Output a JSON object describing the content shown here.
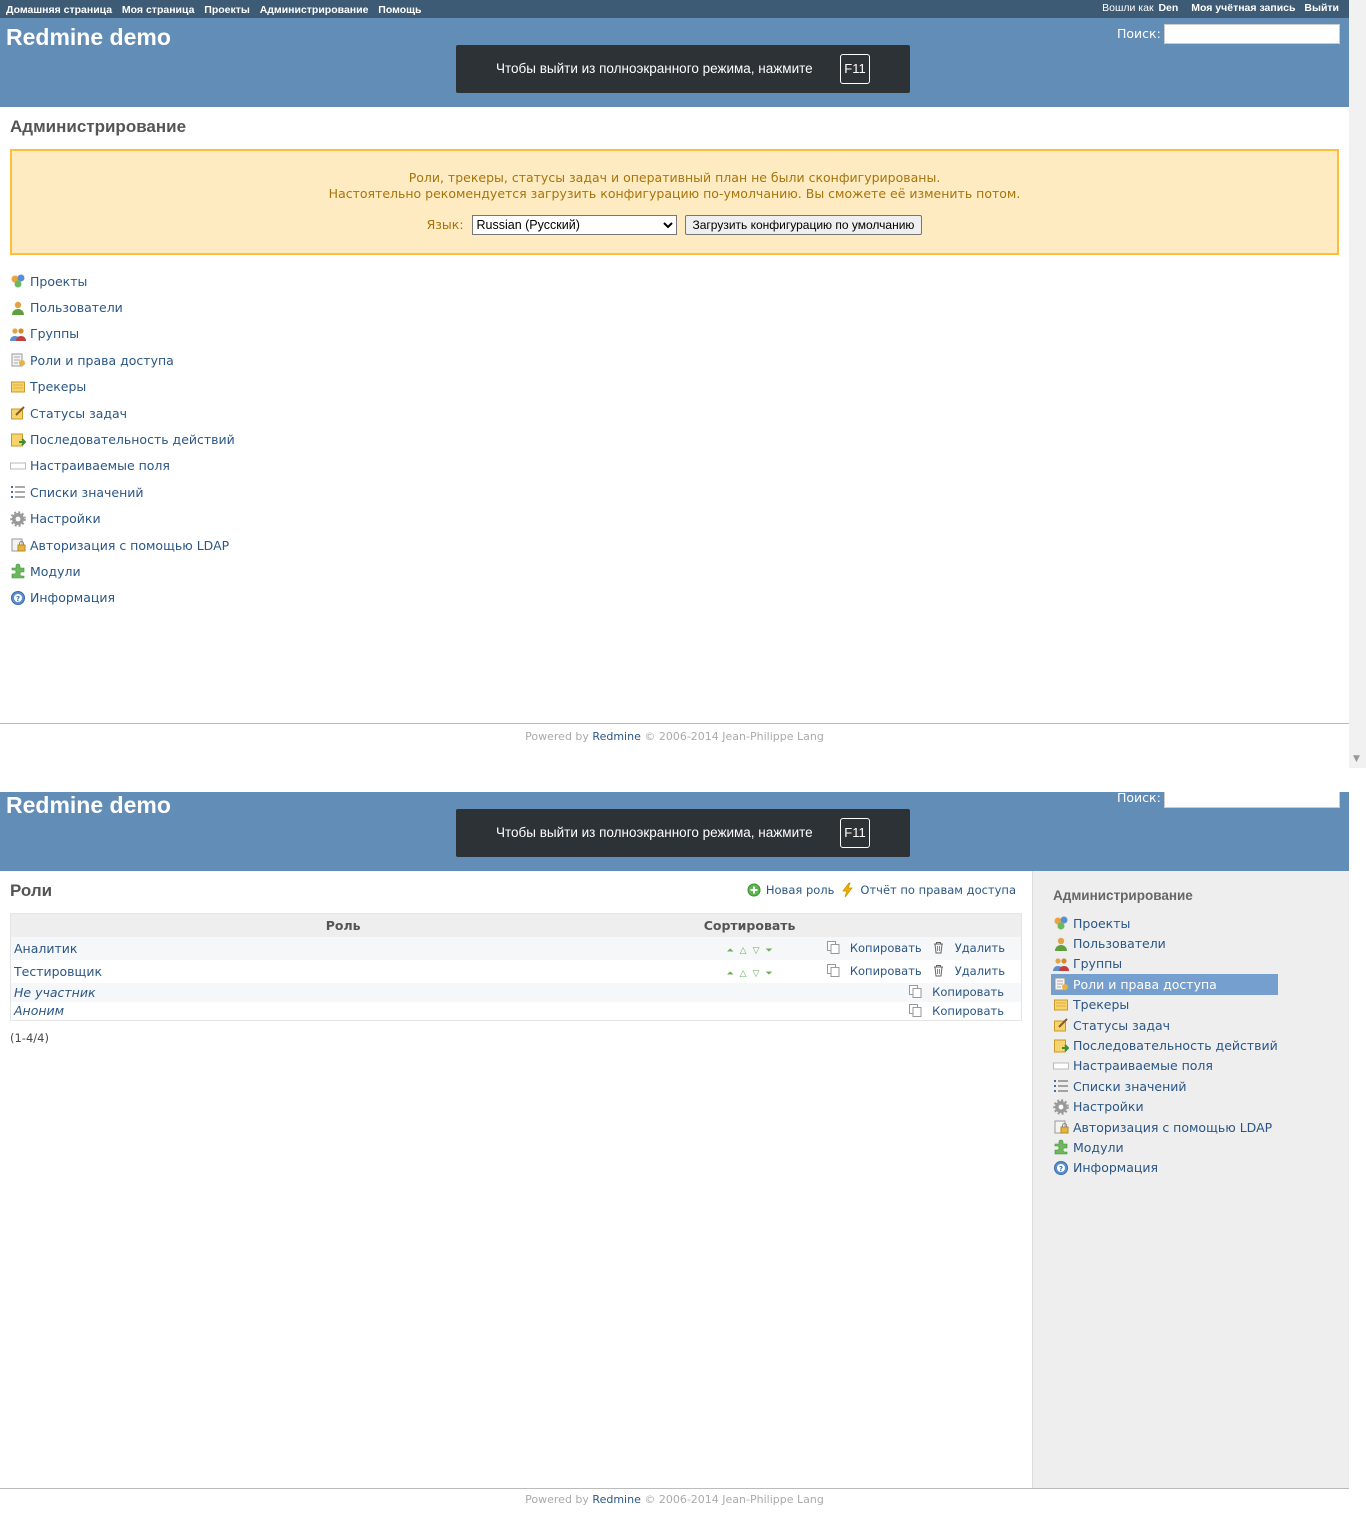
{
  "top_menu": {
    "items": [
      "Домашняя страница",
      "Моя страница",
      "Проекты",
      "Администрирование",
      "Помощь"
    ],
    "logged_in_prefix": "Вошли как",
    "username": "Den",
    "my_account": "Моя учётная запись",
    "logout": "Выйти"
  },
  "header": {
    "site_title": "Redmine demo",
    "search_label": "Поиск:",
    "search_value": ""
  },
  "fullscreen_toast": {
    "message": "Чтобы выйти из полноэкранного режима, нажмите",
    "key": "F11"
  },
  "admin_page": {
    "title": "Администрирование",
    "warning_line1": "Роли, трекеры, статусы задач и оперативный план не были сконфигурированы.",
    "warning_line2": "Настоятельно рекомендуется загрузить конфигурацию по-умолчанию. Вы сможете её изменить потом.",
    "language_label": "Язык:",
    "language_selected": "Russian (Русский)",
    "load_button": "Загрузить конфигурацию по умолчанию"
  },
  "admin_menu": [
    {
      "label": "Проекты",
      "icon": "projects-icon"
    },
    {
      "label": "Пользователи",
      "icon": "user-icon"
    },
    {
      "label": "Группы",
      "icon": "group-icon"
    },
    {
      "label": "Роли и права доступа",
      "icon": "roles-icon"
    },
    {
      "label": "Трекеры",
      "icon": "tracker-icon"
    },
    {
      "label": "Статусы задач",
      "icon": "issue-status-icon"
    },
    {
      "label": "Последовательность действий",
      "icon": "workflow-icon"
    },
    {
      "label": "Настраиваемые поля",
      "icon": "custom-fields-icon"
    },
    {
      "label": "Списки значений",
      "icon": "list-icon"
    },
    {
      "label": "Настройки",
      "icon": "gear-icon"
    },
    {
      "label": "Авторизация с помощью LDAP",
      "icon": "ldap-icon"
    },
    {
      "label": "Модули",
      "icon": "plugin-icon"
    },
    {
      "label": "Информация",
      "icon": "info-icon"
    }
  ],
  "footer": {
    "powered_by": "Powered by",
    "link": "Redmine",
    "copyright": "© 2006-2014 Jean-Philippe Lang"
  },
  "roles_page": {
    "title": "Роли",
    "new_role": "Новая роль",
    "permissions_report": "Отчёт по правам доступа",
    "columns": {
      "role": "Роль",
      "sort": "Сортировать"
    },
    "roles": [
      {
        "name": "Аналитик",
        "builtin": false,
        "copy": "Копировать",
        "delete": "Удалить"
      },
      {
        "name": "Тестировщик",
        "builtin": false,
        "copy": "Копировать",
        "delete": "Удалить"
      },
      {
        "name": "Не участник",
        "builtin": true,
        "copy": "Копировать"
      },
      {
        "name": "Аноним",
        "builtin": true,
        "copy": "Копировать"
      }
    ],
    "pagination": "(1-4/4)"
  },
  "sidebar": {
    "title": "Администрирование",
    "selected_index": 3
  },
  "colors": {
    "top_menu_bg": "#3e5b76",
    "header_bg": "#628db6",
    "link": "#2a5685",
    "warning_bg": "#ffebc1",
    "warning_border": "#fdbf3b",
    "warning_text": "#a6750c",
    "sidebar_bg": "#eeeeee",
    "selected_bg": "#759fcf"
  }
}
